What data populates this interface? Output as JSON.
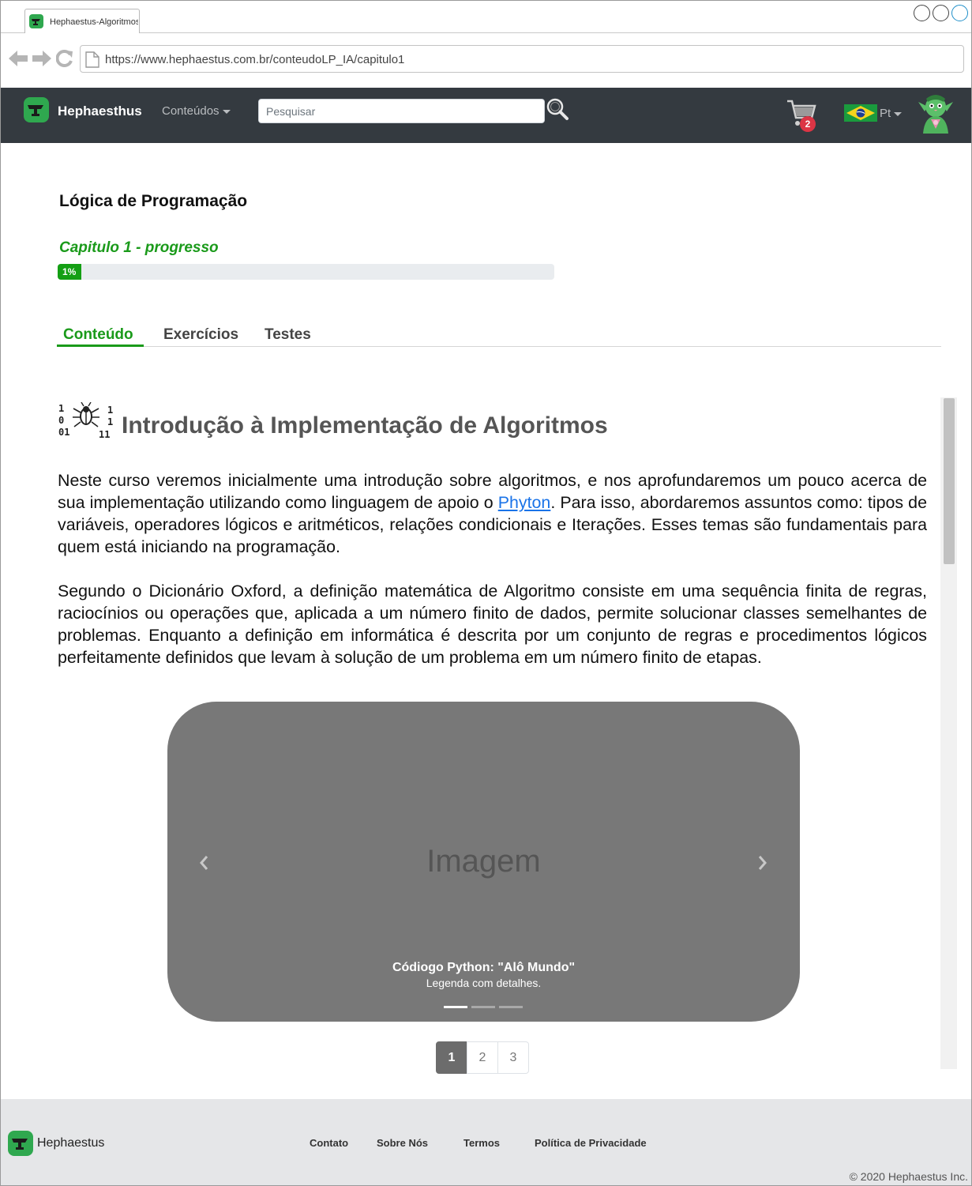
{
  "browser": {
    "tab_title": "Hephaestus-Algoritmos",
    "url": "https://www.hephaestus.com.br/conteudoLP_IA/capitulo1"
  },
  "navbar": {
    "brand": "Hephaesthus",
    "contents_menu": "Conteúdos",
    "search_placeholder": "Pesquisar",
    "cart_count": "2",
    "language": "Pt"
  },
  "course": {
    "title": "Lógica de Programação",
    "progress_label": "Capitulo 1 - progresso",
    "progress_value": "1%",
    "progress_fraction": 0.01
  },
  "tabs": [
    {
      "label": "Conteúdo",
      "active": true
    },
    {
      "label": "Exercícios",
      "active": false
    },
    {
      "label": "Testes",
      "active": false
    }
  ],
  "content": {
    "section_title": "Introdução à Implementação de Algoritmos",
    "p1_before_link": "Neste curso veremos inicialmente uma introdução sobre algoritmos, e nos aprofundaremos um pouco acerca de sua implementação utilizando como linguagem de apoio o ",
    "p1_link": "Phyton",
    "p1_after_link": ". Para isso, abordaremos assuntos como: tipos de variáveis, operadores lógicos e aritméticos, relações condicionais e Iterações. Esses temas são fundamentais para quem está iniciando na programação.",
    "p2": "Segundo o Dicionário Oxford, a definição matemática de Algoritmo consiste em uma sequência finita de regras, raciocínios ou operações que, aplicada a um número finito de dados, permite solucionar classes semelhantes de problemas. Enquanto a definição em informática é descrita por um conjunto de regras e procedimentos lógicos perfeitamente definidos que levam à solução de um problema em um número finito de etapas."
  },
  "carousel": {
    "placeholder": "Imagem",
    "caption_title": "Códiogo Python: \"Alô Mundo\"",
    "caption_text": "Legenda com detalhes.",
    "slides": 3,
    "active_slide": 1
  },
  "pagination": [
    "1",
    "2",
    "3"
  ],
  "footer": {
    "brand": "Hephaestus",
    "links": [
      "Contato",
      "Sobre Nós",
      "Termos",
      "Política de Privacidade"
    ],
    "copyright": "© 2020 Hephaestus Inc."
  },
  "colors": {
    "accent_green": "#1a9a1a",
    "navbar_bg": "#343a40",
    "badge_red": "#dc3545",
    "link_blue": "#1a73e8"
  },
  "icons": {
    "browser_tab": "favicon-anvil-icon",
    "back": "back-arrow-icon",
    "forward": "forward-arrow-icon",
    "reload": "reload-icon",
    "page": "page-icon",
    "brand": "anvil-logo-icon",
    "search": "magnifier-icon",
    "cart": "cart-icon",
    "flag": "brazil-flag-icon",
    "avatar": "goblin-avatar-icon",
    "section": "binary-bug-icon",
    "carousel_prev": "chevron-left-icon",
    "carousel_next": "chevron-right-icon"
  }
}
